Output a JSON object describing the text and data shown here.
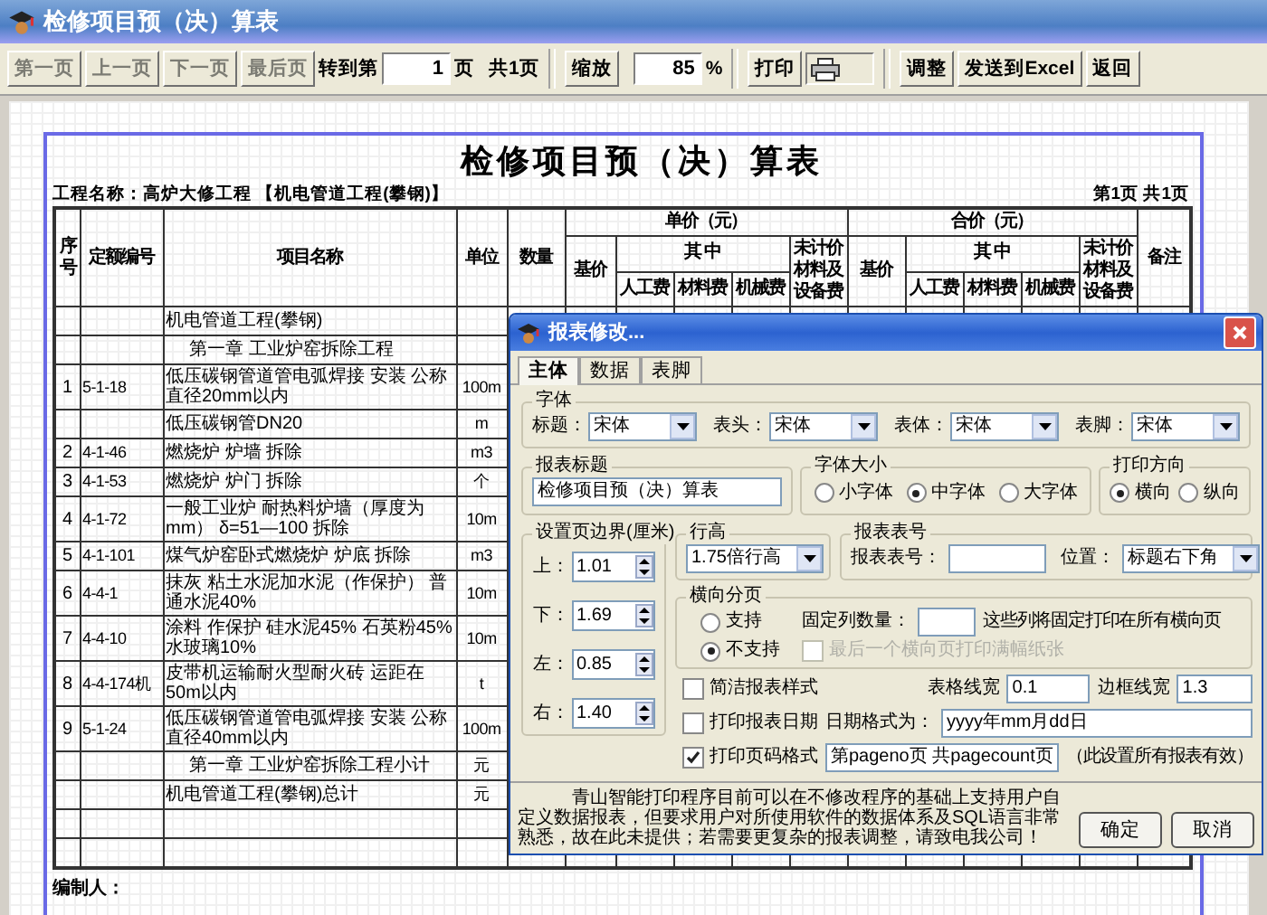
{
  "window": {
    "title": "检修项目预（决）算表"
  },
  "toolbar": {
    "nav_buttons": [
      {
        "label": "第一页",
        "disabled": true
      },
      {
        "label": "上一页",
        "disabled": true
      },
      {
        "label": "下一页",
        "disabled": true
      },
      {
        "label": "最后页",
        "disabled": true
      }
    ],
    "goto_label": "转到第",
    "page_value": "1",
    "page_unit": "页",
    "page_total": "共1页",
    "zoom_button": "缩放",
    "zoom_value": "85",
    "zoom_unit": "%",
    "print_button": "打印",
    "buttons": [
      {
        "label": "调整"
      },
      {
        "label": "发送到Excel"
      },
      {
        "label": "返回"
      }
    ]
  },
  "report": {
    "title": "检修项目预（决）算表",
    "project": "工程名称：高炉大修工程 【机电管道工程(攀钢)】",
    "page_info": "第1页 共1页",
    "columns": [
      "序号",
      "定额编号",
      "项目名称",
      "单位",
      "数量"
    ],
    "groups": [
      {
        "title": "单价（元）",
        "base": "基价",
        "sub_title": "其 中",
        "subs": [
          "人工费",
          "材料费",
          "机械费"
        ],
        "extra": "未计价材料及设备费"
      },
      {
        "title": "合价（元）",
        "base": "基价",
        "sub_title": "其 中",
        "subs": [
          "人工费",
          "材料费",
          "机械费"
        ],
        "extra": "未计价材料及设备费"
      }
    ],
    "remark": "备注",
    "rows": [
      {
        "kind": "heading",
        "name": "机电管道工程(攀钢)"
      },
      {
        "kind": "chapter",
        "name": "第一章 工业炉窑拆除工程"
      },
      {
        "kind": "item",
        "no": "1",
        "code": "5-1-18",
        "name": "低压碳钢管道管电弧焊接 安装 公称直径20mm以内",
        "unit": "100m"
      },
      {
        "kind": "item",
        "name": "低压碳钢管DN20",
        "unit": "m"
      },
      {
        "kind": "item",
        "no": "2",
        "code": "4-1-46",
        "name": "燃烧炉 炉墙 拆除",
        "unit": "m3"
      },
      {
        "kind": "item",
        "no": "3",
        "code": "4-1-53",
        "name": "燃烧炉 炉门 拆除",
        "unit": "个"
      },
      {
        "kind": "item",
        "no": "4",
        "code": "4-1-72",
        "name": "一般工业炉 耐热料炉墙（厚度为mm） δ=51—100 拆除",
        "unit": "10m"
      },
      {
        "kind": "item",
        "no": "5",
        "code": "4-1-101",
        "name": "煤气炉窑卧式燃烧炉 炉底 拆除",
        "unit": "m3"
      },
      {
        "kind": "item",
        "no": "6",
        "code": "4-4-1",
        "name": "抹灰 粘土水泥加水泥（作保护） 普通水泥40%",
        "unit": "10m"
      },
      {
        "kind": "item",
        "no": "7",
        "code": "4-4-10",
        "name": "涂料 作保护 硅水泥45% 石英粉45% 水玻璃10%",
        "unit": "10m"
      },
      {
        "kind": "item",
        "no": "8",
        "code": "4-4-174机",
        "name": "皮带机运输耐火型耐火砖 运距在50m以内",
        "unit": "t"
      },
      {
        "kind": "item",
        "no": "9",
        "code": "5-1-24",
        "name": "低压碳钢管道管电弧焊接 安装 公称直径40mm以内",
        "unit": "100m"
      },
      {
        "kind": "chapter",
        "name": "第一章 工业炉窑拆除工程小计",
        "unit": "元"
      },
      {
        "kind": "heading",
        "name": "机电管道工程(攀钢)总计",
        "unit": "元"
      }
    ],
    "footer": "编制人："
  },
  "dialog": {
    "title": "报表修改...",
    "tabs": [
      {
        "label": "主体",
        "selected": true
      },
      {
        "label": "数据",
        "selected": false
      },
      {
        "label": "表脚",
        "selected": false
      }
    ],
    "font_group": {
      "title": "字体",
      "fields": [
        {
          "label": "标题：",
          "value": "宋体"
        },
        {
          "label": "表头：",
          "value": "宋体"
        },
        {
          "label": "表体：",
          "value": "宋体"
        },
        {
          "label": "表脚：",
          "value": "宋体"
        }
      ]
    },
    "title_group": {
      "title": "报表标题",
      "value": "检修项目预（决）算表"
    },
    "size_group": {
      "title": "字体大小",
      "options": [
        {
          "label": "小字体",
          "selected": false
        },
        {
          "label": "中字体",
          "selected": true
        },
        {
          "label": "大字体",
          "selected": false
        }
      ]
    },
    "orientation_group": {
      "title": "打印方向",
      "options": [
        {
          "label": "横向",
          "selected": true
        },
        {
          "label": "纵向",
          "selected": false
        }
      ]
    },
    "margin_group": {
      "title": "设置页边界(厘米)",
      "fields": [
        {
          "label": "上：",
          "value": "1.01"
        },
        {
          "label": "下：",
          "value": "1.69"
        },
        {
          "label": "左：",
          "value": "0.85"
        },
        {
          "label": "右：",
          "value": "1.40"
        }
      ]
    },
    "row_height_group": {
      "title": "行高",
      "value": "1.75倍行高"
    },
    "number_group": {
      "title": "报表表号",
      "number_label": "报表表号：",
      "position_label": "位置：",
      "position_value": "标题右下角"
    },
    "paging_group": {
      "title": "横向分页",
      "options": [
        {
          "label": "支持",
          "selected": false
        },
        {
          "label": "不支持",
          "selected": true
        }
      ],
      "fixed_label": "固定列数量：",
      "fixed_note": "这些列将固定打印在所有横向页",
      "last_page": {
        "label": "最后一个横向页打印满幅纸张",
        "checked": false,
        "disabled": true
      }
    },
    "simple_style": {
      "label": "简洁报表样式",
      "checked": false
    },
    "grid_width": {
      "label": "表格线宽",
      "value": "0.1"
    },
    "border_width": {
      "label": "边框线宽",
      "value": "1.3"
    },
    "print_date": {
      "label": "打印报表日期",
      "checked": false
    },
    "date_format": {
      "label": "日期格式为：",
      "value": "yyyy年mm月dd日"
    },
    "print_page": {
      "label": "打印页码格式",
      "checked": true
    },
    "page_format": {
      "value": "第pageno页 共pagecount页",
      "note": "（此设置所有报表有效）"
    },
    "notice": "青山智能打印程序目前可以在不修改程序的基础上支持用户自定义数据报表，但要求用户对所使用软件的数据体系及SQL语言非常熟悉，故在此未提供；若需要更复杂的报表调整，请致电我公司！",
    "buttons": [
      {
        "label": "确定"
      },
      {
        "label": "取消"
      }
    ]
  }
}
